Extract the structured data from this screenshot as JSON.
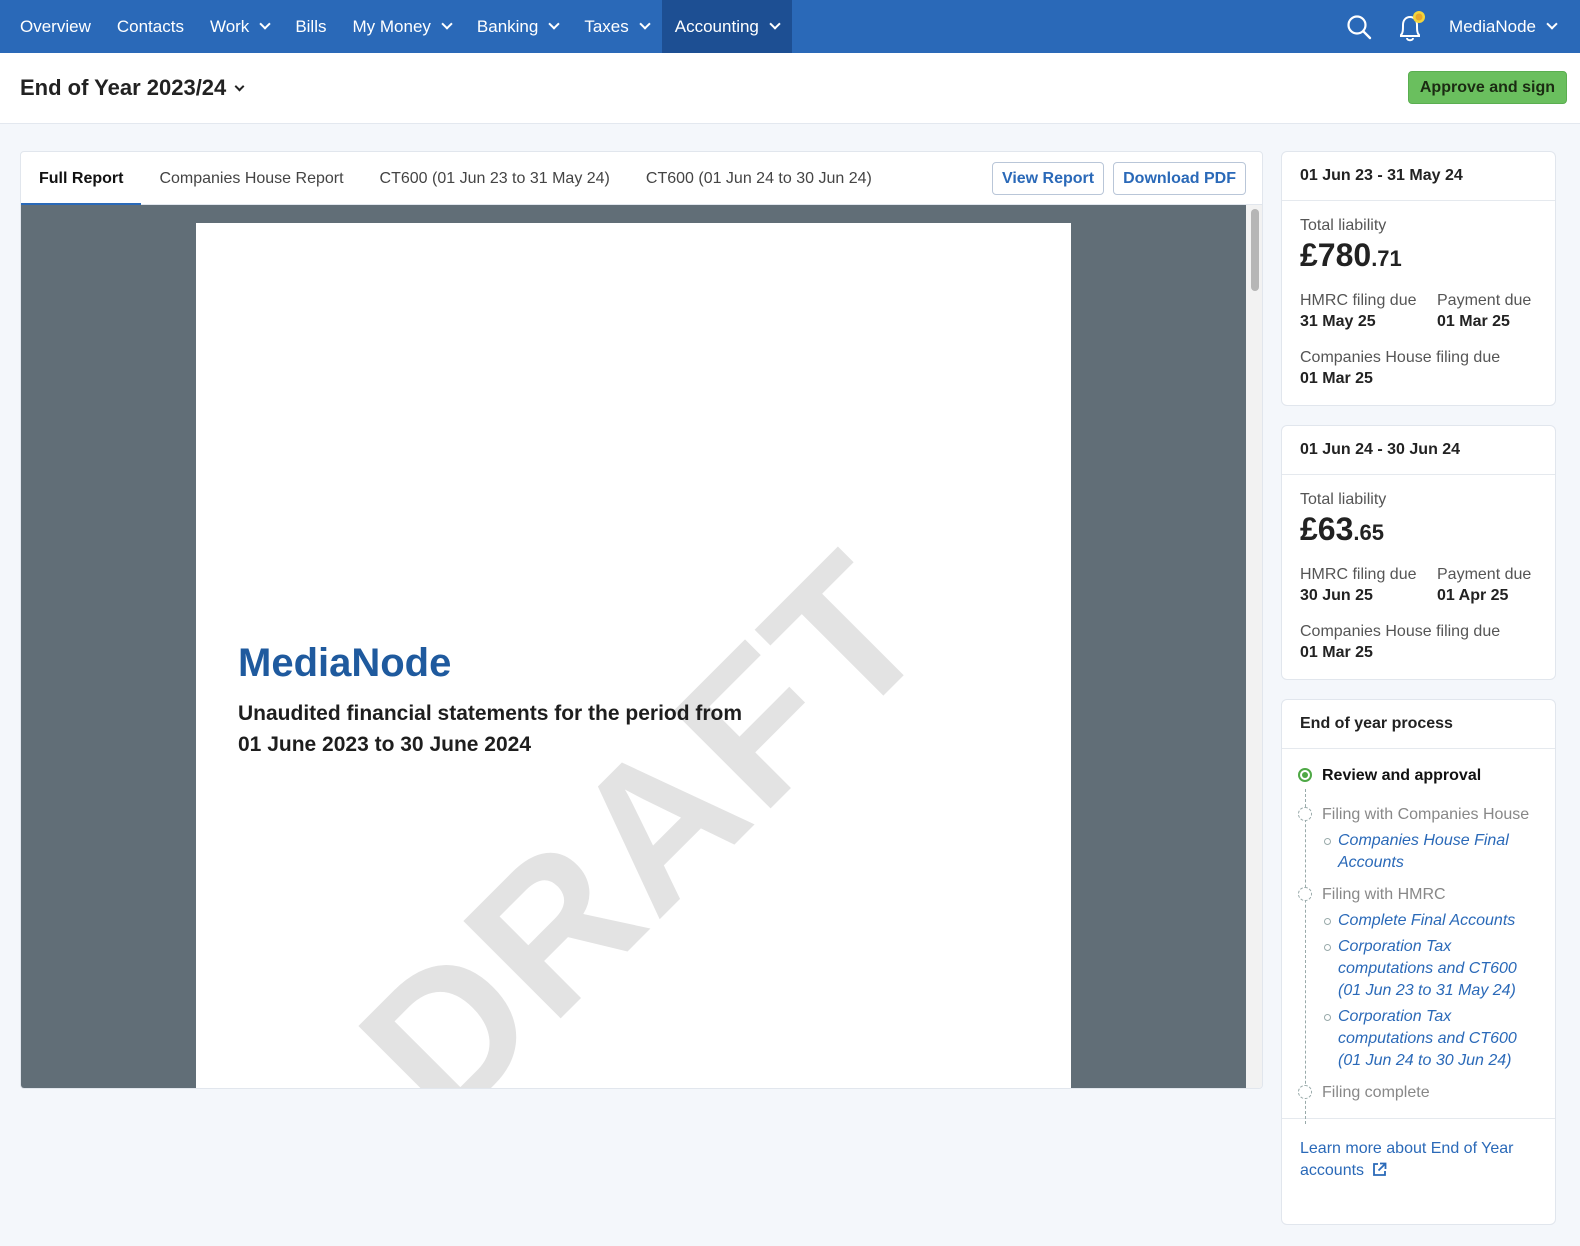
{
  "nav": {
    "items": [
      {
        "label": "Overview",
        "dropdown": false
      },
      {
        "label": "Contacts",
        "dropdown": false
      },
      {
        "label": "Work",
        "dropdown": true
      },
      {
        "label": "Bills",
        "dropdown": false
      },
      {
        "label": "My Money",
        "dropdown": true
      },
      {
        "label": "Banking",
        "dropdown": true
      },
      {
        "label": "Taxes",
        "dropdown": true
      },
      {
        "label": "Accounting",
        "dropdown": true,
        "active": true
      }
    ],
    "user": "MediaNode",
    "icons": [
      "search-icon",
      "bell-icon"
    ],
    "accent": "#2a69b8",
    "active_bg": "#1d4f93"
  },
  "header": {
    "title": "End of Year 2023/24",
    "approve_label": "Approve and sign"
  },
  "report": {
    "tabs": [
      {
        "label": "Full Report",
        "active": true
      },
      {
        "label": "Companies House Report"
      },
      {
        "label": "CT600 (01 Jun 23 to 31 May 24)"
      },
      {
        "label": "CT600 (01 Jun 24 to 30 Jun 24)"
      }
    ],
    "view_label": "View Report",
    "download_label": "Download PDF",
    "doc": {
      "company": "MediaNode",
      "subtitle": "Unaudited financial statements for the period from 01 June 2023 to 30 June 2024",
      "watermark": "DRAFT"
    }
  },
  "periods": [
    {
      "title": "01 Jun 23 - 31 May 24",
      "liability_label": "Total liability",
      "amount_main": "£780",
      "amount_pence": ".71",
      "hmrc_label": "HMRC filing due",
      "hmrc_date": "31 May 25",
      "payment_label": "Payment due",
      "payment_date": "01 Mar 25",
      "ch_label": "Companies House filing due",
      "ch_date": "01 Mar 25"
    },
    {
      "title": "01 Jun 24 - 30 Jun 24",
      "liability_label": "Total liability",
      "amount_main": "£63",
      "amount_pence": ".65",
      "hmrc_label": "HMRC filing due",
      "hmrc_date": "30 Jun 25",
      "payment_label": "Payment due",
      "payment_date": "01 Apr 25",
      "ch_label": "Companies House filing due",
      "ch_date": "01 Mar 25"
    }
  ],
  "process": {
    "title": "End of year process",
    "steps": [
      {
        "label": "Review and approval",
        "done": true,
        "links": []
      },
      {
        "label": "Filing with Companies House",
        "done": false,
        "links": [
          "Companies House Final Accounts"
        ]
      },
      {
        "label": "Filing with HMRC",
        "done": false,
        "links": [
          "Complete Final Accounts",
          "Corporation Tax computations and CT600 (01 Jun 23 to 31 May 24)",
          "Corporation Tax computations and CT600 (01 Jun 24 to 30 Jun 24)"
        ]
      },
      {
        "label": "Filing complete",
        "done": false,
        "links": []
      }
    ],
    "learn_more": "Learn more about End of Year accounts"
  }
}
